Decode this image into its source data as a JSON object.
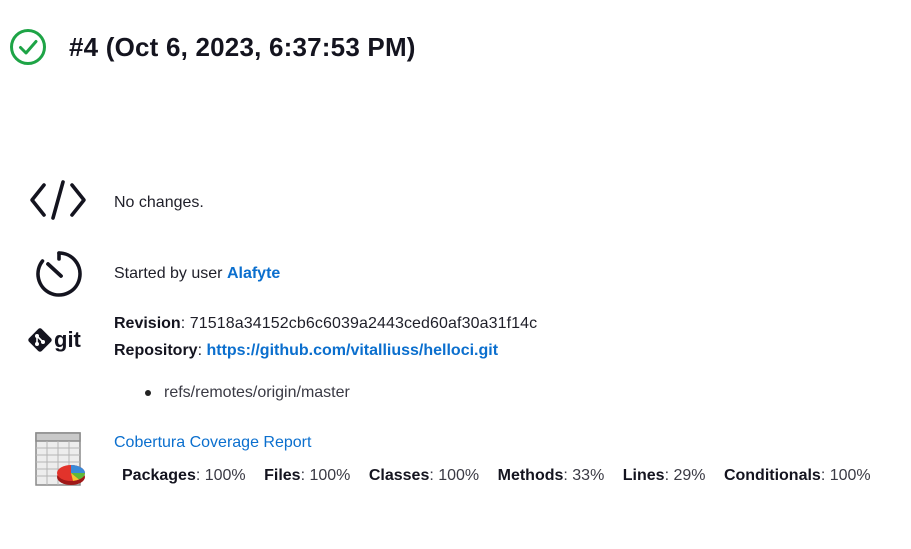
{
  "build": {
    "title": "#4 (Oct 6, 2023, 6:37:53 PM)",
    "status_color": "#1ea446"
  },
  "changes": {
    "text": "No changes.",
    "icon": "code-icon"
  },
  "cause": {
    "prefix": "Started by user ",
    "user": "Alafyte",
    "icon": "timer-icon"
  },
  "git": {
    "icon": "git-logo",
    "revision_label": "Revision",
    "revision_value": ": 71518a34152cb6c6039a2443ced60af30a31f14c",
    "repository_label": "Repository",
    "repository_sep": ": ",
    "repository_url": "https://github.com/vitalliuss/helloci.git",
    "branches": [
      "refs/remotes/origin/master"
    ]
  },
  "coverage": {
    "icon": "coverage-report-icon",
    "link": "Cobertura Coverage Report",
    "stats": [
      {
        "label": "Packages",
        "value": ": 100%"
      },
      {
        "label": "Files",
        "value": ": 100%"
      },
      {
        "label": "Classes",
        "value": ": 100%"
      },
      {
        "label": "Methods",
        "value": ": 33%"
      },
      {
        "label": "Lines",
        "value": ": 29%"
      },
      {
        "label": "Conditionals",
        "value": ": 100%"
      }
    ]
  }
}
